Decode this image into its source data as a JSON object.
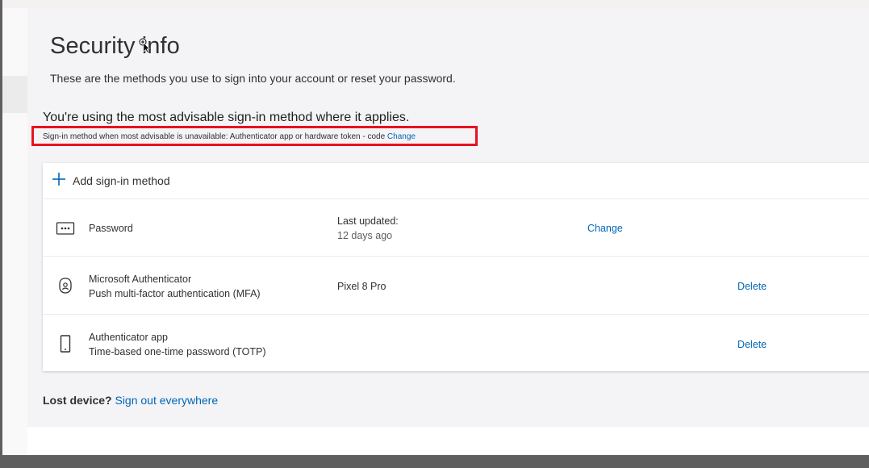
{
  "page": {
    "title": "Security info",
    "subtitle": "These are the methods you use to sign into your account or reset your password.",
    "advisable_text": "You're using the most advisable sign-in method where it applies.",
    "fallback_text": "Sign-in method when most advisable is unavailable: Authenticator app or hardware token - code",
    "fallback_change_label": "Change"
  },
  "add_method": {
    "label": "Add sign-in method"
  },
  "methods": [
    {
      "name": "Password",
      "sub": "",
      "detail_label": "Last updated:",
      "detail_value": "12 days ago",
      "action": "Change",
      "icon": "password-dots-icon"
    },
    {
      "name": "Microsoft Authenticator",
      "sub": "Push multi-factor authentication (MFA)",
      "detail_label": "Pixel 8 Pro",
      "detail_value": "",
      "action": "Delete",
      "icon": "authenticator-lock-icon"
    },
    {
      "name": "Authenticator app",
      "sub": "Time-based one-time password (TOTP)",
      "detail_label": "",
      "detail_value": "",
      "action": "Delete",
      "icon": "phone-icon"
    }
  ],
  "footer": {
    "lost_device_label": "Lost device?",
    "sign_out_label": "Sign out everywhere"
  },
  "colors": {
    "link": "#0067b8",
    "highlight_border": "#e81123"
  }
}
